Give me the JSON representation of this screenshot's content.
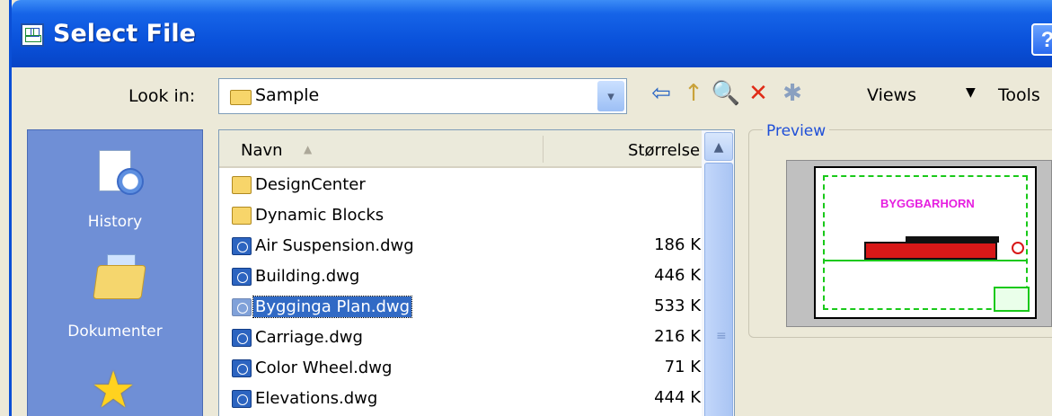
{
  "window": {
    "title": "Select File",
    "help_label": "?"
  },
  "toolbar": {
    "lookin_label": "Look in:",
    "lookin_value": "Sample",
    "dropdown_glyph": "▾",
    "buttons": [
      {
        "name": "back",
        "icon": "back-arrow-icon",
        "glyph": "⇦"
      },
      {
        "name": "up-one-level",
        "icon": "folder-up-icon",
        "glyph": "↑"
      },
      {
        "name": "search-web",
        "icon": "search-icon",
        "glyph": "🔍"
      },
      {
        "name": "delete",
        "icon": "delete-icon",
        "glyph": "✕"
      },
      {
        "name": "create-folder",
        "icon": "new-folder-icon",
        "glyph": "✱"
      }
    ],
    "views_label": "Views",
    "views_arrow": "▼",
    "tools_label": "Tools"
  },
  "places": [
    {
      "label": "History",
      "icon": "history-icon"
    },
    {
      "label": "Dokumenter",
      "icon": "documents-folder-icon"
    },
    {
      "label": "",
      "icon": "favorites-star-icon"
    }
  ],
  "file_list": {
    "columns": {
      "name": "Navn",
      "size": "Størrelse"
    },
    "sort_glyph": "▲",
    "scroll_up_glyph": "▲",
    "scroll_grip_glyph": "≡",
    "rows": [
      {
        "name": "DesignCenter",
        "size": "",
        "type": "folder",
        "selected": false
      },
      {
        "name": "Dynamic Blocks",
        "size": "",
        "type": "folder",
        "selected": false
      },
      {
        "name": "Air Suspension.dwg",
        "size": "186 K",
        "type": "dwg",
        "selected": false
      },
      {
        "name": "Building.dwg",
        "size": "446 K",
        "type": "dwg",
        "selected": false
      },
      {
        "name": "Bygginga Plan.dwg",
        "size": "533 K",
        "type": "dwg",
        "selected": true
      },
      {
        "name": "Carriage.dwg",
        "size": "216 K",
        "type": "dwg",
        "selected": false
      },
      {
        "name": "Color Wheel.dwg",
        "size": "71 K",
        "type": "dwg",
        "selected": false
      },
      {
        "name": "Elevations.dwg",
        "size": "444 K",
        "type": "dwg",
        "selected": false
      }
    ]
  },
  "preview": {
    "label": "Preview",
    "drawing_title": "BYGGBARHORN"
  },
  "colors": {
    "titlebar": "#0a52db",
    "selection": "#316ac5",
    "places_bar": "#6f8fd6",
    "preview_label": "#1f4fd8"
  }
}
